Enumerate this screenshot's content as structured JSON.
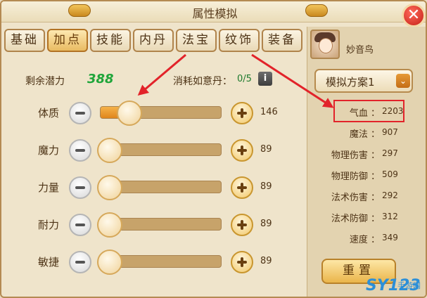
{
  "window": {
    "title": "属性模拟",
    "close_label": "✕"
  },
  "tabs": [
    {
      "label": "基础",
      "active": false
    },
    {
      "label": "加点",
      "active": true
    },
    {
      "label": "技能",
      "active": false
    },
    {
      "label": "内丹",
      "active": false
    },
    {
      "label": "法宝",
      "active": false
    },
    {
      "label": "纹饰",
      "active": false
    },
    {
      "label": "装备",
      "active": false
    }
  ],
  "potential": {
    "label": "剩余潜力",
    "value": "388"
  },
  "pill": {
    "label": "消耗如意丹：",
    "value": "0/5",
    "info_label": "i"
  },
  "attributes": [
    {
      "name": "体质",
      "value": "146",
      "fill": 0.24
    },
    {
      "name": "魔力",
      "value": "89",
      "fill": 0.08
    },
    {
      "name": "力量",
      "value": "89",
      "fill": 0.08
    },
    {
      "name": "耐力",
      "value": "89",
      "fill": 0.08
    },
    {
      "name": "敏捷",
      "value": "89",
      "fill": 0.08
    }
  ],
  "character": {
    "name": "妙音鸟"
  },
  "plan": {
    "selected": "模拟方案1",
    "chevron": "⌄"
  },
  "stats": [
    {
      "name": "气血",
      "value": "2203"
    },
    {
      "name": "魔法",
      "value": "907"
    },
    {
      "name": "物理伤害",
      "value": "297"
    },
    {
      "name": "物理防御",
      "value": "509"
    },
    {
      "name": "法术伤害",
      "value": "292"
    },
    {
      "name": "法术防御",
      "value": "312"
    },
    {
      "name": "速度",
      "value": "349"
    }
  ],
  "stat_separator": "：",
  "reset_label": "重置",
  "watermark": {
    "text": "SY123",
    "sub": "手游网"
  },
  "colors": {
    "accent": "#e0861c",
    "highlight": "#e2232a",
    "potential": "#1fa53a"
  }
}
